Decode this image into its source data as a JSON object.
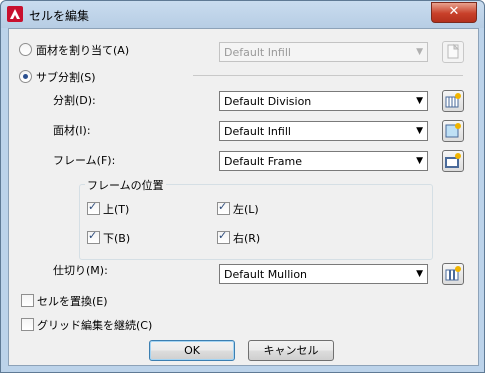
{
  "window": {
    "title": "セルを編集",
    "close_glyph": "✕"
  },
  "assign_material": {
    "label": "面材を割り当て(A)",
    "combo_value": "Default Infill"
  },
  "subdivision": {
    "label": "サブ分割(S)",
    "division": {
      "label": "分割(D):",
      "value": "Default Division"
    },
    "infill": {
      "label": "面材(I):",
      "value": "Default Infill"
    },
    "frame": {
      "label": "フレーム(F):",
      "value": "Default Frame"
    },
    "frame_position": {
      "title": "フレームの位置",
      "top": "上(T)",
      "left": "左(L)",
      "bottom": "下(B)",
      "right": "右(R)"
    },
    "mullion": {
      "label": "仕切り(M):",
      "value": "Default Mullion"
    }
  },
  "replace_cell": {
    "label": "セルを置換(E)"
  },
  "continue_grid": {
    "label": "グリッド編集を継続(C)"
  },
  "buttons": {
    "ok": "OK",
    "cancel": "キャンセル"
  },
  "colors": {
    "accent": "#3c7fb1",
    "close": "#c8402a",
    "icon_yellow": "#f0b400"
  }
}
